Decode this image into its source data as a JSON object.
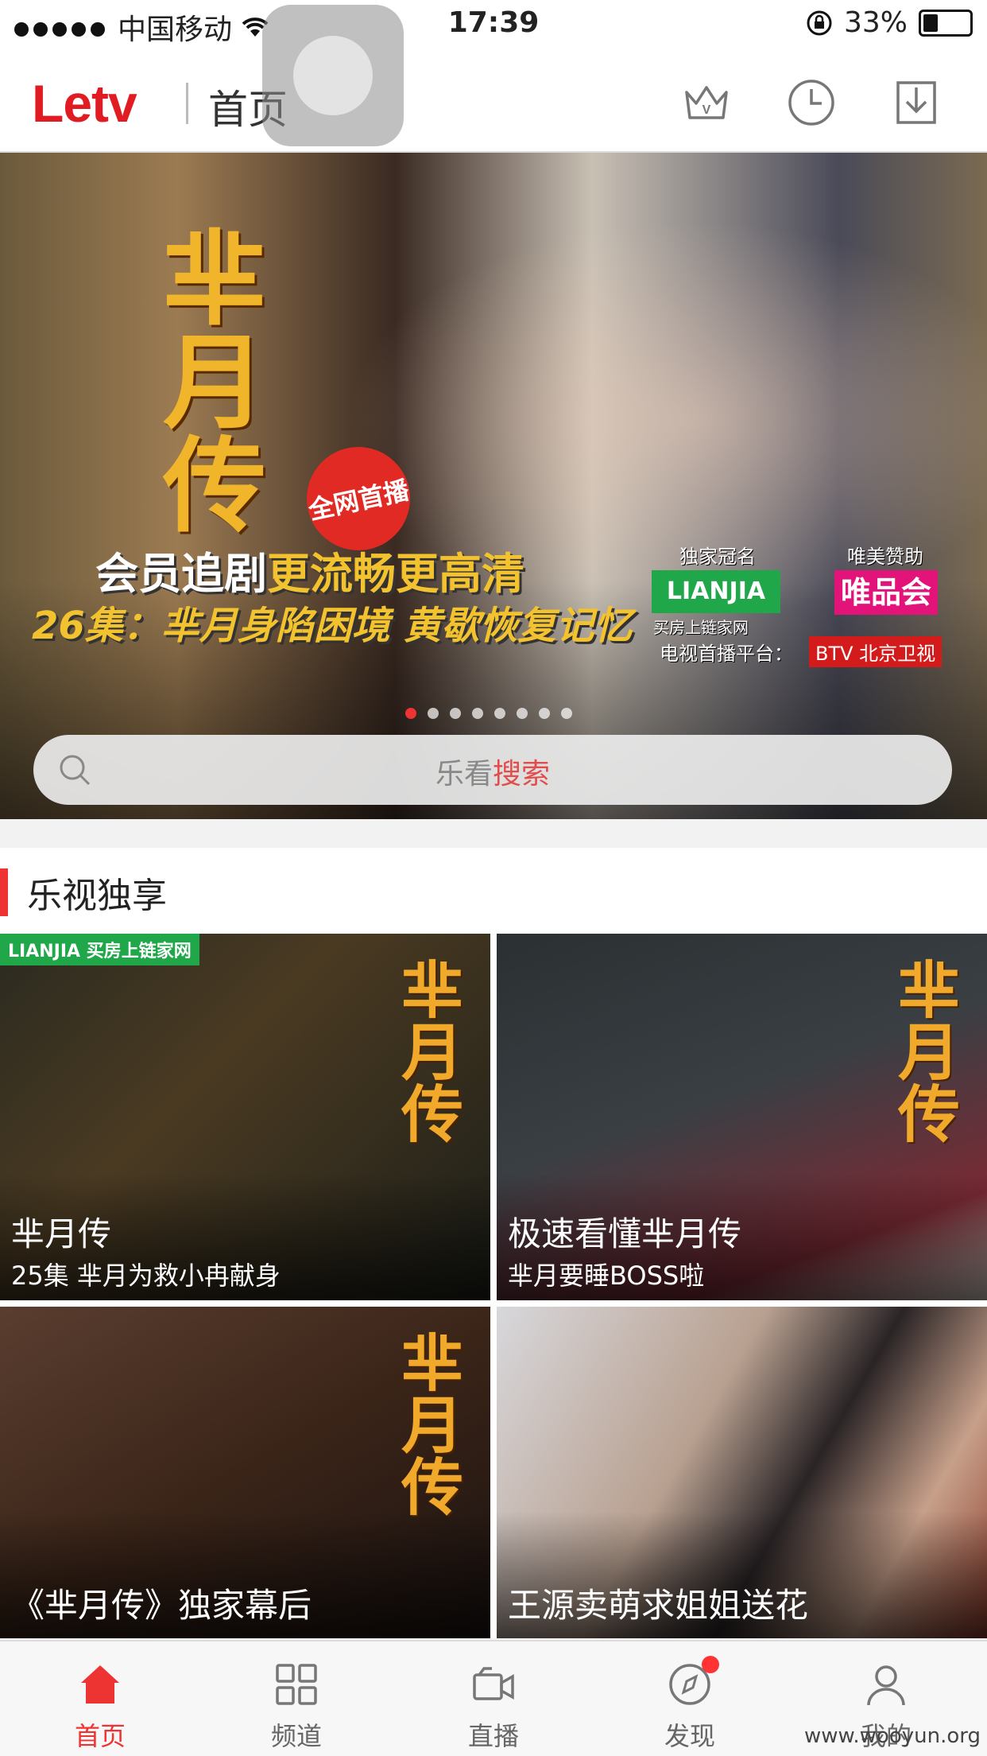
{
  "status_bar": {
    "carrier": "中国移动",
    "time": "17:39",
    "battery": "33%"
  },
  "header": {
    "logo": "Letv",
    "title": "首页"
  },
  "banner": {
    "show_title": "芈月传",
    "badge": "全网首播",
    "line1_prefix": "会员追剧",
    "line1_highlight": "更流畅更高清",
    "line2": "26集：芈月身陷困境 黄歇恢复记忆",
    "sponsor_label_1": "独家冠名",
    "sponsor_1": "LIANJIA",
    "sponsor_1_sub": "买房上链家网",
    "sponsor_label_2": "唯美赞助",
    "sponsor_2": "唯品会",
    "tv_label": "电视首播平台：",
    "tv_channel": "BTV 北京卫视",
    "page_count": 8,
    "active_page": 1
  },
  "search": {
    "placeholder_prefix": "乐看",
    "placeholder_highlight": "搜索"
  },
  "section": {
    "title": "乐视独享"
  },
  "tiles": [
    {
      "title": "芈月传",
      "subtitle": "25集 芈月为救小冉献身",
      "watermark": "芈月传",
      "sponsor": "LIANJIA 买房上链家网"
    },
    {
      "title": "极速看懂芈月传",
      "subtitle": "芈月要睡BOSS啦",
      "watermark": "芈月传"
    },
    {
      "title": "《芈月传》独家幕后",
      "watermark": "芈月传"
    },
    {
      "title": "王源卖萌求姐姐送花"
    }
  ],
  "tabs": [
    {
      "label": "首页",
      "icon": "home-icon",
      "active": true
    },
    {
      "label": "频道",
      "icon": "grid-icon"
    },
    {
      "label": "直播",
      "icon": "camera-icon"
    },
    {
      "label": "发现",
      "icon": "compass-icon",
      "badge": true
    },
    {
      "label": "我的",
      "icon": "person-icon"
    }
  ],
  "watermark": "www.wooyun.org",
  "colors": {
    "brand": "#e11b22",
    "accent": "#e33333"
  }
}
